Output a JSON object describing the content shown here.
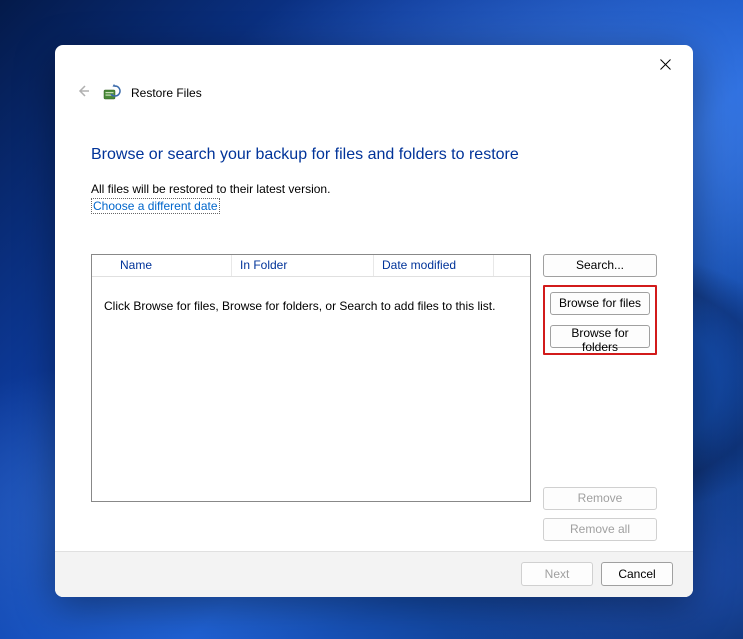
{
  "header": {
    "title": "Restore Files"
  },
  "instruction": "Browse or search your backup for files and folders to restore",
  "subtext": "All files will be restored to their latest version.",
  "link": "Choose a different date",
  "columns": {
    "name": "Name",
    "in_folder": "In Folder",
    "date_modified": "Date modified"
  },
  "empty_message": "Click Browse for files, Browse for folders, or Search to add files to this list.",
  "buttons": {
    "search": "Search...",
    "browse_files": "Browse for files",
    "browse_folders": "Browse for folders",
    "remove": "Remove",
    "remove_all": "Remove all",
    "next": "Next",
    "cancel": "Cancel"
  }
}
